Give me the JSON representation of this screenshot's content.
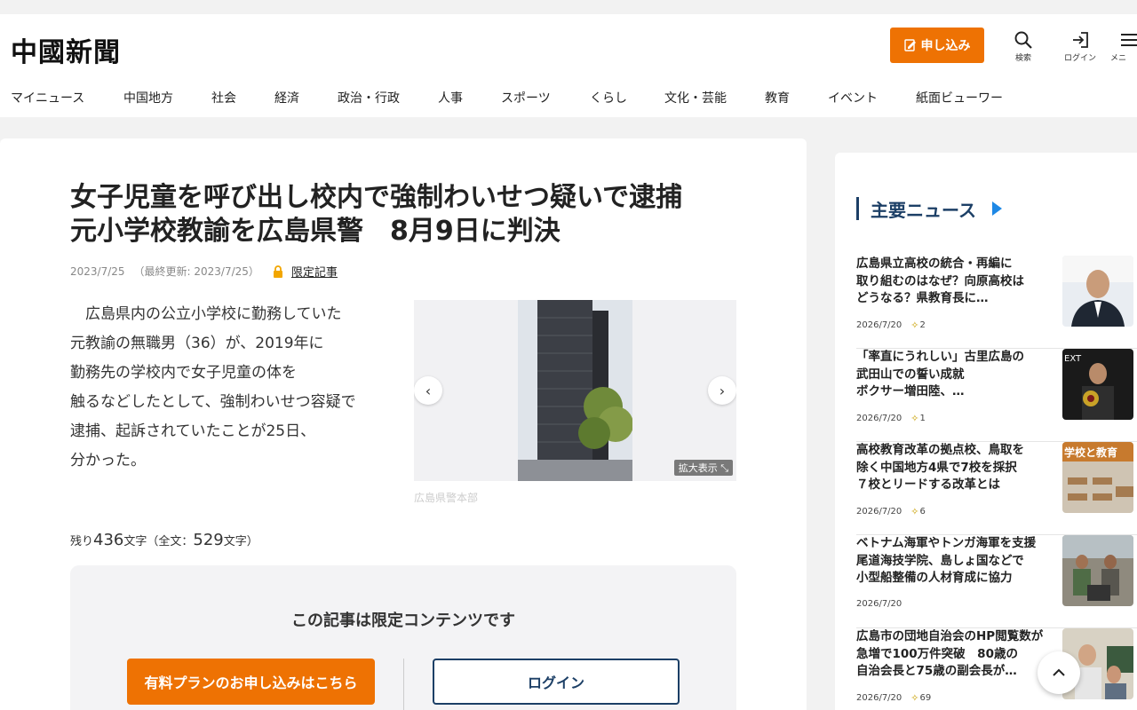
{
  "header": {
    "logo": "中國新聞",
    "apply_label": "申し込み",
    "search_label": "検索",
    "login_label": "ログイン",
    "menu_label": "メニ"
  },
  "nav": [
    "マイニュース",
    "中国地方",
    "社会",
    "経済",
    "政治・行政",
    "人事",
    "スポーツ",
    "くらし",
    "文化・芸能",
    "教育",
    "イベント",
    "紙面ビューワー"
  ],
  "article": {
    "title_lines": [
      "女子児童を呼び出し校内で強制わいせつ疑いで逮捕",
      "元小学校教諭を広島県警　8月9日に判決"
    ],
    "date": "2023/7/25",
    "updated": "（最終更新: 2023/7/25）",
    "limited_label": "限定記事",
    "body_lines": [
      "　広島県内の公立小学校に勤務していた",
      "元教諭の無職男（36）が、2019年に",
      "勤務先の学校内で女子児童の体を",
      "触るなどしたとして、強制わいせつ容疑で",
      "逮捕、起訴されていたことが25日、",
      "分かった。"
    ],
    "photo_zoom": "拡大表示",
    "photo_caption": "広島県警本部",
    "remain_prefix": "残り",
    "remain_count": "436",
    "remain_mid": "文字（全文：",
    "total_count": "529",
    "remain_suffix": "文字）"
  },
  "paywall": {
    "title": "この記事は限定コンテンツです",
    "plan_button": "有料プランのお申し込みはこちら",
    "login_button": "ログイン"
  },
  "sidebar": {
    "title": "主要ニュース",
    "items": [
      {
        "title_lines": [
          "広島県立高校の統合・再編に",
          "取り組むのはなぜ？向原高校は",
          "どうなる？県教育長に…"
        ],
        "date": "2026/7/20",
        "count": "2",
        "thumb_text": ""
      },
      {
        "title_lines": [
          "「率直にうれしい」古里広島の",
          "武田山での誓い成就",
          "ボクサー増田陸、…"
        ],
        "date": "2026/7/20",
        "count": "1",
        "thumb_text": "EXT"
      },
      {
        "title_lines": [
          "高校教育改革の拠点校、鳥取を",
          "除く中国地方4県で7校を採択",
          "７校とリードする改革とは"
        ],
        "date": "2026/7/20",
        "count": "6",
        "thumb_text": "学校と教育"
      },
      {
        "title_lines": [
          "ベトナム海軍やトンガ海軍を支援",
          "尾道海技学院、島しょ国などで",
          "小型船整備の人材育成に協力"
        ],
        "date": "2026/7/20",
        "count": "",
        "thumb_text": ""
      },
      {
        "title_lines": [
          "広島市の団地自治会のHP閲覧数が",
          "急増で100万件突破　80歳の",
          "自治会長と75歳の副会長が…"
        ],
        "date": "2026/7/20",
        "count": "69",
        "thumb_text": ""
      }
    ]
  },
  "colors": {
    "accent": "#ee7203",
    "navy": "#1c3f66"
  }
}
